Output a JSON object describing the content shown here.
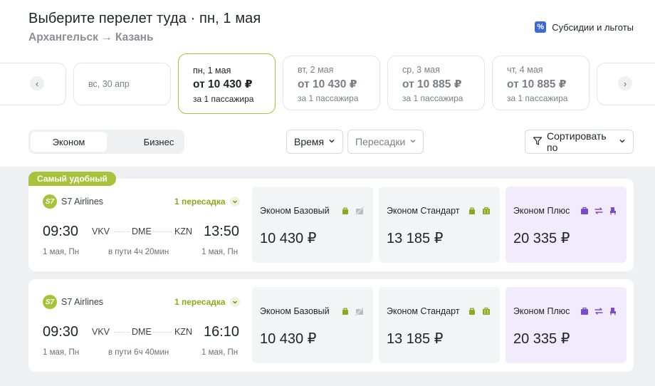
{
  "header": {
    "title": "Выберите перелет туда · пн, 1 мая",
    "route": "Архангельск → Казань",
    "subsidy_icon": "%",
    "subsidy_label": "Субсидии и льготы"
  },
  "date_strip": {
    "prev_icon": "‹",
    "next_icon": "›",
    "cards": [
      {
        "label": "вс, 30 апр"
      },
      {
        "label": "пн, 1 мая",
        "price": "от 10 430 ₽",
        "pax": "за 1 пассажира",
        "selected": true
      },
      {
        "label": "вт, 2 мая",
        "price": "от 10 430 ₽",
        "pax": "за 1 пассажира"
      },
      {
        "label": "ср, 3 мая",
        "price": "от 10 885 ₽",
        "pax": "за 1 пассажира"
      },
      {
        "label": "чт, 4 мая",
        "price": "от 10 885 ₽",
        "pax": "за 1 пассажира"
      }
    ]
  },
  "filters": {
    "tab_economy": "Эконом",
    "tab_business": "Бизнес",
    "time_label": "Время",
    "transfers_label": "Пересадки",
    "sort_label": "Сортировать по"
  },
  "badge": "Самый удобный",
  "flights": [
    {
      "airline": "S7 Airlines",
      "airline_logo": "S7",
      "stops": "1 пересадка",
      "dep_time": "09:30",
      "arr_time": "13:50",
      "from": "VKV",
      "via": "DME",
      "to": "KZN",
      "dep_date": "1 мая, Пн",
      "duration": "в пути 4ч 20мин",
      "arr_date": "1 мая, Пн",
      "fares": [
        {
          "name": "Эконом Базовый",
          "price": "10 430 ₽"
        },
        {
          "name": "Эконом Стандарт",
          "price": "13 185 ₽"
        },
        {
          "name": "Эконом Плюс",
          "price": "20 335 ₽"
        }
      ]
    },
    {
      "airline": "S7 Airlines",
      "airline_logo": "S7",
      "stops": "1 пересадка",
      "dep_time": "09:30",
      "arr_time": "16:10",
      "from": "VKV",
      "via": "DME",
      "to": "KZN",
      "dep_date": "1 мая, Пн",
      "duration": "в пути 6ч 40мин",
      "arr_date": "1 мая, Пн",
      "fares": [
        {
          "name": "Эконом Базовый",
          "price": "10 430 ₽"
        },
        {
          "name": "Эконом Стандарт",
          "price": "13 185 ₽"
        },
        {
          "name": "Эконом Плюс",
          "price": "20 335 ₽"
        }
      ]
    }
  ],
  "colors": {
    "accent": "#a6c33a",
    "plus_bg": "#f2ebfb",
    "plus_icon": "#7b4cc9",
    "results_bg": "#eef0f3"
  }
}
